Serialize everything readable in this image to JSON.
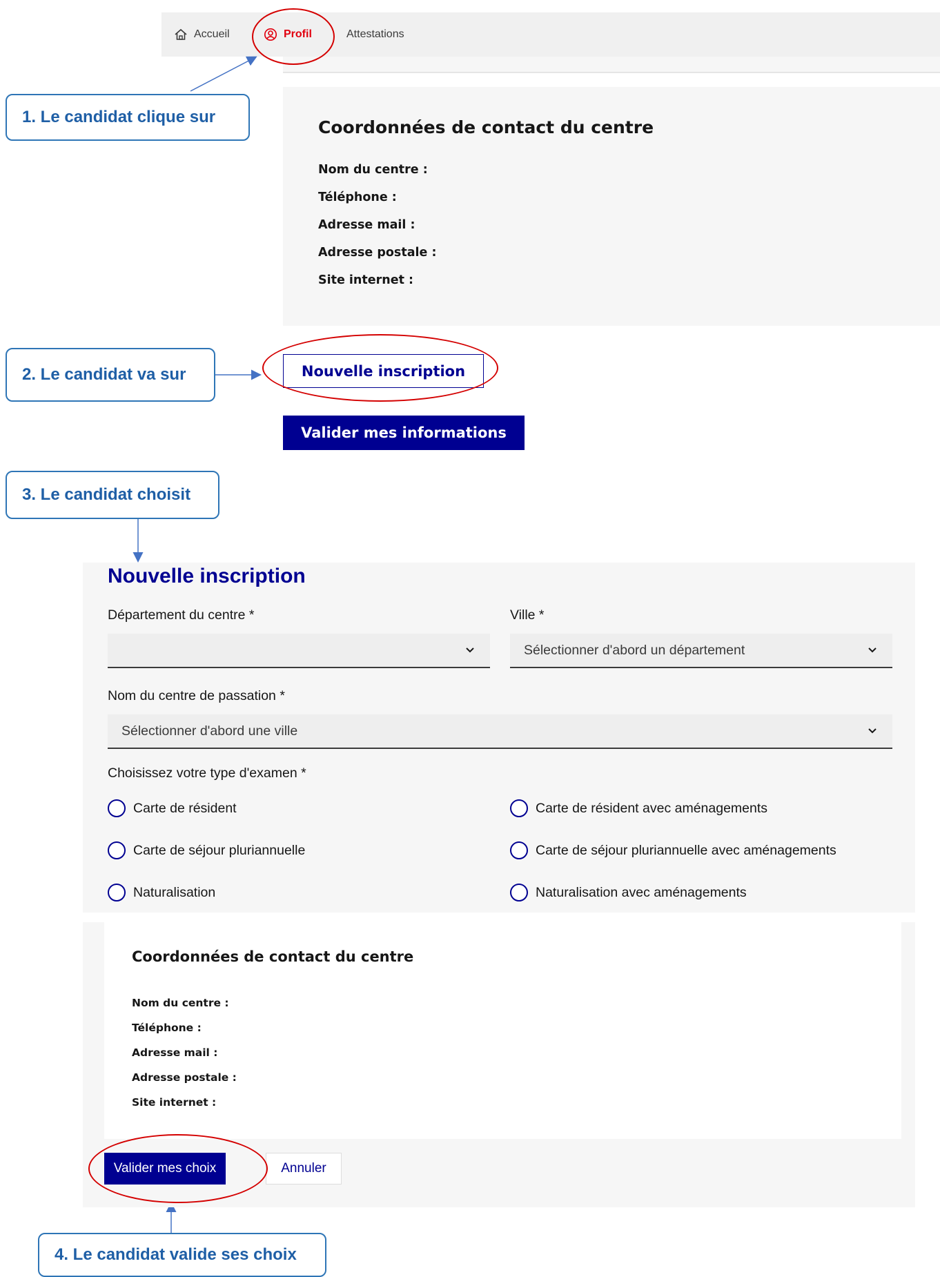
{
  "nav": {
    "items": [
      {
        "label": "Accueil",
        "icon": "home-icon"
      },
      {
        "label": "Profil",
        "icon": "user-circle-icon",
        "active": true,
        "color": "#e1000f"
      },
      {
        "label": "Attestations"
      }
    ]
  },
  "profile_card": {
    "title": "Coordonnées de contact du centre",
    "fields": [
      "Nom du centre :",
      "Téléphone :",
      "Adresse mail :",
      "Adresse postale :",
      "Site internet :"
    ]
  },
  "buttons": {
    "nouvelle_inscription": "Nouvelle inscription",
    "valider_informations": "Valider mes informations"
  },
  "callouts": {
    "step1": "1. Le candidat clique sur",
    "step2": "2. Le candidat va sur",
    "step3": "3. Le candidat choisit",
    "step4": "4. Le candidat valide ses choix"
  },
  "form": {
    "title": "Nouvelle inscription",
    "departement_label": "Département du centre",
    "departement_value": "",
    "ville_label": "Ville",
    "ville_placeholder": "Sélectionner d'abord un département",
    "centre_label": "Nom du centre de passation",
    "centre_placeholder": "Sélectionner d'abord une ville",
    "exam_label": "Choisissez votre type d'examen",
    "required_mark": "*",
    "exam_options": [
      "Carte de résident",
      "Carte de résident avec aménagements",
      "Carte de séjour pluriannuelle",
      "Carte de séjour pluriannuelle avec aménagements",
      "Naturalisation",
      "Naturalisation avec aménagements"
    ],
    "contact_card": {
      "title": "Coordonnées de contact du centre",
      "fields": [
        "Nom du centre :",
        "Téléphone :",
        "Adresse mail :",
        "Adresse postale :",
        "Site internet :"
      ]
    },
    "submit": "Valider mes choix",
    "cancel": "Annuler"
  },
  "colors": {
    "primary": "#000091",
    "callout_border": "#2e75b6",
    "callout_text": "#1f5fa6",
    "highlight_ellipse": "#d40000"
  }
}
